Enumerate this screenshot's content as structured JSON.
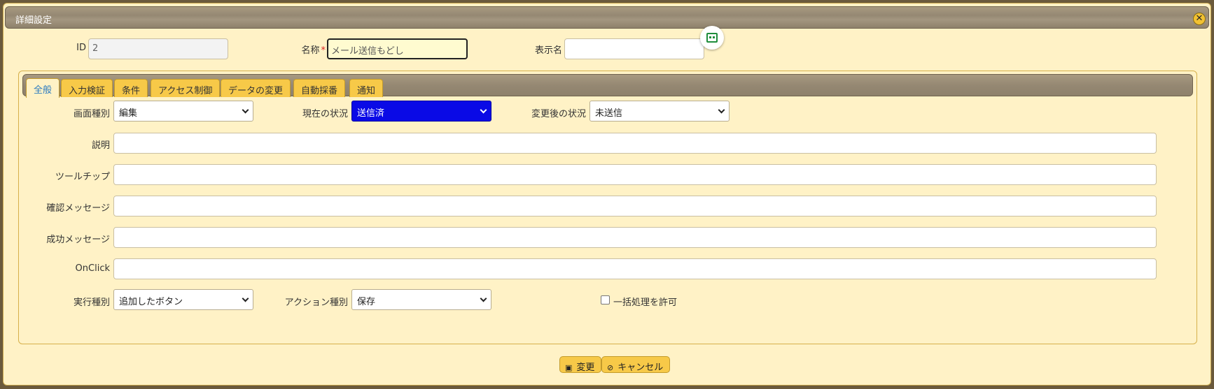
{
  "dialog": {
    "title": "詳細設定",
    "close_icon": "close-icon"
  },
  "header": {
    "id_label": "ID",
    "id_value": "2",
    "name_label": "名称",
    "name_required": "*",
    "name_value": "メール送信もどし",
    "display_name_label": "表示名",
    "display_name_value": ""
  },
  "tabs": [
    {
      "label": "全般",
      "active": true
    },
    {
      "label": "入力検証"
    },
    {
      "label": "条件"
    },
    {
      "label": "アクセス制御"
    },
    {
      "label": "データの変更"
    },
    {
      "label": "自動採番"
    },
    {
      "label": "通知"
    }
  ],
  "general": {
    "screen_type_label": "画面種別",
    "screen_type_value": "編集",
    "current_status_label": "現在の状況",
    "current_status_value": "送信済",
    "current_status_color": "#0a0ae6",
    "after_status_label": "変更後の状況",
    "after_status_value": "未送信",
    "description_label": "説明",
    "description_value": "",
    "tooltip_label": "ツールチップ",
    "tooltip_value": "",
    "confirm_message_label": "確認メッセージ",
    "confirm_message_value": "",
    "success_message_label": "成功メッセージ",
    "success_message_value": "",
    "onclick_label": "OnClick",
    "onclick_value": "",
    "exec_type_label": "実行種別",
    "exec_type_value": "追加したボタン",
    "action_type_label": "アクション種別",
    "action_type_value": "保存",
    "bulk_label": "一括処理を許可",
    "bulk_checked": false
  },
  "footer": {
    "change_label": "変更",
    "cancel_label": "キャンセル"
  }
}
